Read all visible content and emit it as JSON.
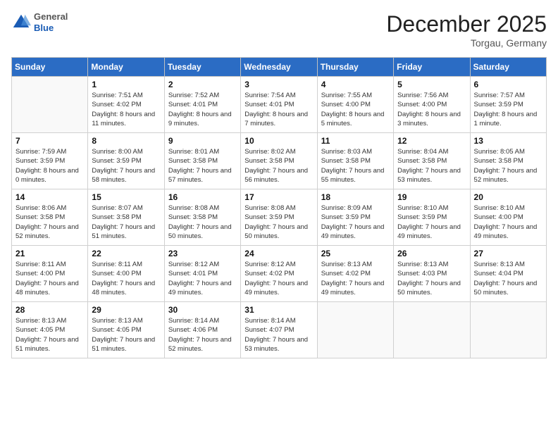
{
  "header": {
    "logo_general": "General",
    "logo_blue": "Blue",
    "month_title": "December 2025",
    "location": "Torgau, Germany"
  },
  "weekdays": [
    "Sunday",
    "Monday",
    "Tuesday",
    "Wednesday",
    "Thursday",
    "Friday",
    "Saturday"
  ],
  "weeks": [
    [
      {
        "day": "",
        "sunrise": "",
        "sunset": "",
        "daylight": ""
      },
      {
        "day": "1",
        "sunrise": "Sunrise: 7:51 AM",
        "sunset": "Sunset: 4:02 PM",
        "daylight": "Daylight: 8 hours and 11 minutes."
      },
      {
        "day": "2",
        "sunrise": "Sunrise: 7:52 AM",
        "sunset": "Sunset: 4:01 PM",
        "daylight": "Daylight: 8 hours and 9 minutes."
      },
      {
        "day": "3",
        "sunrise": "Sunrise: 7:54 AM",
        "sunset": "Sunset: 4:01 PM",
        "daylight": "Daylight: 8 hours and 7 minutes."
      },
      {
        "day": "4",
        "sunrise": "Sunrise: 7:55 AM",
        "sunset": "Sunset: 4:00 PM",
        "daylight": "Daylight: 8 hours and 5 minutes."
      },
      {
        "day": "5",
        "sunrise": "Sunrise: 7:56 AM",
        "sunset": "Sunset: 4:00 PM",
        "daylight": "Daylight: 8 hours and 3 minutes."
      },
      {
        "day": "6",
        "sunrise": "Sunrise: 7:57 AM",
        "sunset": "Sunset: 3:59 PM",
        "daylight": "Daylight: 8 hours and 1 minute."
      }
    ],
    [
      {
        "day": "7",
        "sunrise": "Sunrise: 7:59 AM",
        "sunset": "Sunset: 3:59 PM",
        "daylight": "Daylight: 8 hours and 0 minutes."
      },
      {
        "day": "8",
        "sunrise": "Sunrise: 8:00 AM",
        "sunset": "Sunset: 3:59 PM",
        "daylight": "Daylight: 7 hours and 58 minutes."
      },
      {
        "day": "9",
        "sunrise": "Sunrise: 8:01 AM",
        "sunset": "Sunset: 3:58 PM",
        "daylight": "Daylight: 7 hours and 57 minutes."
      },
      {
        "day": "10",
        "sunrise": "Sunrise: 8:02 AM",
        "sunset": "Sunset: 3:58 PM",
        "daylight": "Daylight: 7 hours and 56 minutes."
      },
      {
        "day": "11",
        "sunrise": "Sunrise: 8:03 AM",
        "sunset": "Sunset: 3:58 PM",
        "daylight": "Daylight: 7 hours and 55 minutes."
      },
      {
        "day": "12",
        "sunrise": "Sunrise: 8:04 AM",
        "sunset": "Sunset: 3:58 PM",
        "daylight": "Daylight: 7 hours and 53 minutes."
      },
      {
        "day": "13",
        "sunrise": "Sunrise: 8:05 AM",
        "sunset": "Sunset: 3:58 PM",
        "daylight": "Daylight: 7 hours and 52 minutes."
      }
    ],
    [
      {
        "day": "14",
        "sunrise": "Sunrise: 8:06 AM",
        "sunset": "Sunset: 3:58 PM",
        "daylight": "Daylight: 7 hours and 52 minutes."
      },
      {
        "day": "15",
        "sunrise": "Sunrise: 8:07 AM",
        "sunset": "Sunset: 3:58 PM",
        "daylight": "Daylight: 7 hours and 51 minutes."
      },
      {
        "day": "16",
        "sunrise": "Sunrise: 8:08 AM",
        "sunset": "Sunset: 3:58 PM",
        "daylight": "Daylight: 7 hours and 50 minutes."
      },
      {
        "day": "17",
        "sunrise": "Sunrise: 8:08 AM",
        "sunset": "Sunset: 3:59 PM",
        "daylight": "Daylight: 7 hours and 50 minutes."
      },
      {
        "day": "18",
        "sunrise": "Sunrise: 8:09 AM",
        "sunset": "Sunset: 3:59 PM",
        "daylight": "Daylight: 7 hours and 49 minutes."
      },
      {
        "day": "19",
        "sunrise": "Sunrise: 8:10 AM",
        "sunset": "Sunset: 3:59 PM",
        "daylight": "Daylight: 7 hours and 49 minutes."
      },
      {
        "day": "20",
        "sunrise": "Sunrise: 8:10 AM",
        "sunset": "Sunset: 4:00 PM",
        "daylight": "Daylight: 7 hours and 49 minutes."
      }
    ],
    [
      {
        "day": "21",
        "sunrise": "Sunrise: 8:11 AM",
        "sunset": "Sunset: 4:00 PM",
        "daylight": "Daylight: 7 hours and 48 minutes."
      },
      {
        "day": "22",
        "sunrise": "Sunrise: 8:11 AM",
        "sunset": "Sunset: 4:00 PM",
        "daylight": "Daylight: 7 hours and 48 minutes."
      },
      {
        "day": "23",
        "sunrise": "Sunrise: 8:12 AM",
        "sunset": "Sunset: 4:01 PM",
        "daylight": "Daylight: 7 hours and 49 minutes."
      },
      {
        "day": "24",
        "sunrise": "Sunrise: 8:12 AM",
        "sunset": "Sunset: 4:02 PM",
        "daylight": "Daylight: 7 hours and 49 minutes."
      },
      {
        "day": "25",
        "sunrise": "Sunrise: 8:13 AM",
        "sunset": "Sunset: 4:02 PM",
        "daylight": "Daylight: 7 hours and 49 minutes."
      },
      {
        "day": "26",
        "sunrise": "Sunrise: 8:13 AM",
        "sunset": "Sunset: 4:03 PM",
        "daylight": "Daylight: 7 hours and 50 minutes."
      },
      {
        "day": "27",
        "sunrise": "Sunrise: 8:13 AM",
        "sunset": "Sunset: 4:04 PM",
        "daylight": "Daylight: 7 hours and 50 minutes."
      }
    ],
    [
      {
        "day": "28",
        "sunrise": "Sunrise: 8:13 AM",
        "sunset": "Sunset: 4:05 PM",
        "daylight": "Daylight: 7 hours and 51 minutes."
      },
      {
        "day": "29",
        "sunrise": "Sunrise: 8:13 AM",
        "sunset": "Sunset: 4:05 PM",
        "daylight": "Daylight: 7 hours and 51 minutes."
      },
      {
        "day": "30",
        "sunrise": "Sunrise: 8:14 AM",
        "sunset": "Sunset: 4:06 PM",
        "daylight": "Daylight: 7 hours and 52 minutes."
      },
      {
        "day": "31",
        "sunrise": "Sunrise: 8:14 AM",
        "sunset": "Sunset: 4:07 PM",
        "daylight": "Daylight: 7 hours and 53 minutes."
      },
      {
        "day": "",
        "sunrise": "",
        "sunset": "",
        "daylight": ""
      },
      {
        "day": "",
        "sunrise": "",
        "sunset": "",
        "daylight": ""
      },
      {
        "day": "",
        "sunrise": "",
        "sunset": "",
        "daylight": ""
      }
    ]
  ]
}
